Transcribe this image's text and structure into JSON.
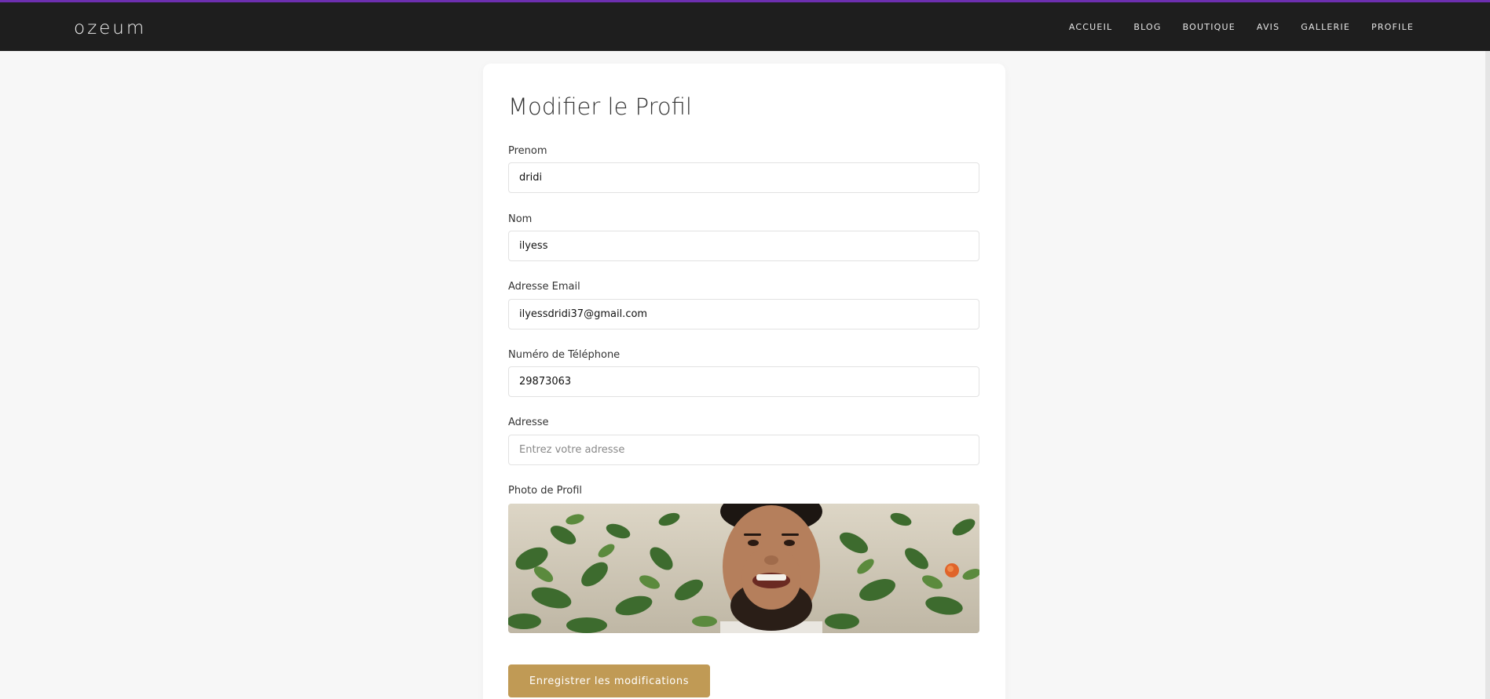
{
  "navbar": {
    "brand": "ozeum",
    "links": [
      {
        "label": "ACCUEIL"
      },
      {
        "label": "BLOG"
      },
      {
        "label": "BOUTIQUE"
      },
      {
        "label": "AVIS"
      },
      {
        "label": "GALLERIE"
      },
      {
        "label": "PROFILE"
      }
    ]
  },
  "form": {
    "title": "Modifier le Profil",
    "prenom": {
      "label": "Prenom",
      "value": "dridi"
    },
    "nom": {
      "label": "Nom",
      "value": "ilyess"
    },
    "email": {
      "label": "Adresse Email",
      "value": "ilyessdridi37@gmail.com"
    },
    "telephone": {
      "label": "Numéro de Téléphone",
      "value": "29873063"
    },
    "adresse": {
      "label": "Adresse",
      "value": "",
      "placeholder": "Entrez votre adresse"
    },
    "photo": {
      "label": "Photo de Profil"
    },
    "save_label": "Enregistrer les modifications"
  },
  "colors": {
    "accent_top": "#6d2fb0",
    "navbar_bg": "#1e1e1e",
    "button_bg": "#c09a55",
    "page_bg": "#f7f7f7"
  }
}
